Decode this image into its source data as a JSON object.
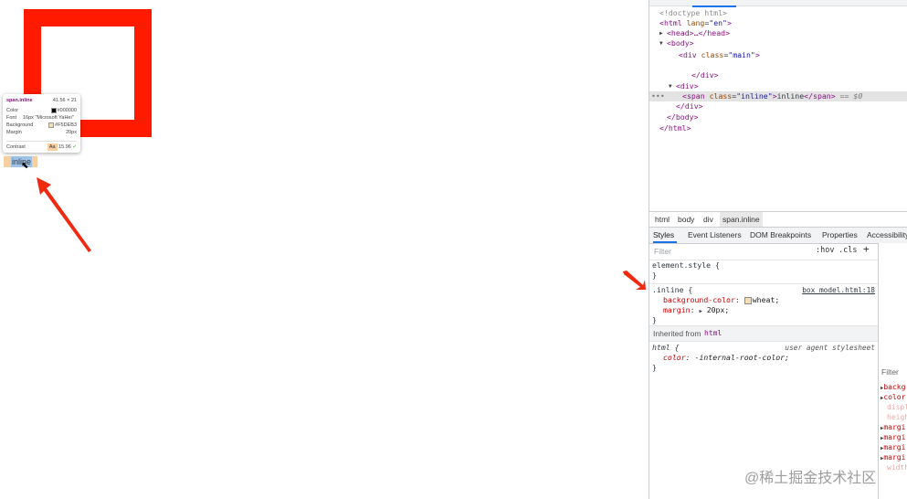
{
  "viewport": {
    "inline_text": "inline",
    "tooltip": {
      "selector": "span.inline",
      "dimensions": "41.56 × 21",
      "color_label": "Color",
      "color_value": "#000000",
      "font_label": "Font",
      "font_value": "16px \"Microsoft YaHei\"",
      "background_label": "Background",
      "background_value": "#F5DEB3",
      "margin_label": "Margin",
      "margin_value": "20px",
      "contrast_label": "Contrast",
      "contrast_badge": "Aa",
      "contrast_value": "15.96"
    }
  },
  "elements": {
    "lines": [
      {
        "indent": 0,
        "html": "<!doctype html>"
      },
      {
        "indent": 0,
        "open_tag": "html",
        "attr": "lang",
        "val": "en"
      },
      {
        "indent": 1,
        "collapsed": "<head>…</head>"
      },
      {
        "indent": 1,
        "open": "<body>"
      },
      {
        "indent": 2,
        "open_tag": "div",
        "attr": "class",
        "val": "main"
      },
      {
        "indent": 3,
        "close": "</div>"
      },
      {
        "indent": 2,
        "open": "<div>"
      },
      {
        "indent": 3,
        "span_tag": "span",
        "attr": "class",
        "val": "inline",
        "text": "inline",
        "marker": "== $0"
      },
      {
        "indent": 2,
        "close": "</div>"
      },
      {
        "indent": 1,
        "close": "</body>"
      },
      {
        "indent": 0,
        "close": "</html>"
      }
    ]
  },
  "breadcrumbs": [
    "html",
    "body",
    "div",
    "span.inline"
  ],
  "panel_tabs": [
    "Styles",
    "Event Listeners",
    "DOM Breakpoints",
    "Properties",
    "Accessibility"
  ],
  "styles": {
    "filter_placeholder": "Filter",
    "hov": ":hov",
    "cls": ".cls",
    "plus": "+",
    "element_style": {
      "selector": "element.style {",
      "close": "}"
    },
    "inline_rule": {
      "selector": ".inline {",
      "source": "box_model.html:18",
      "props": [
        {
          "name": "background-color",
          "value": "wheat;"
        },
        {
          "name": "margin",
          "value": "20px;"
        }
      ],
      "close": "}"
    },
    "inherited_label": "Inherited from",
    "inherited_tag": "html",
    "html_rule": {
      "selector": "html {",
      "source": "user agent stylesheet",
      "prop_name": "color",
      "prop_value": "-internal-root-color;",
      "close": "}"
    }
  },
  "computed": {
    "filter": "Filter",
    "props": [
      "backg",
      "color",
      "displ",
      "heigh",
      "margi",
      "margi",
      "margi",
      "margi",
      "width"
    ]
  },
  "watermark": "@稀土掘金技术社区",
  "colors": {
    "red_box": "#ff1a00",
    "wheat": "#f5deb3",
    "tag": "#881280",
    "attr": "#994500",
    "attr_value": "#1a1aa6",
    "prop": "#c80000",
    "accent": "#1a73e8"
  }
}
